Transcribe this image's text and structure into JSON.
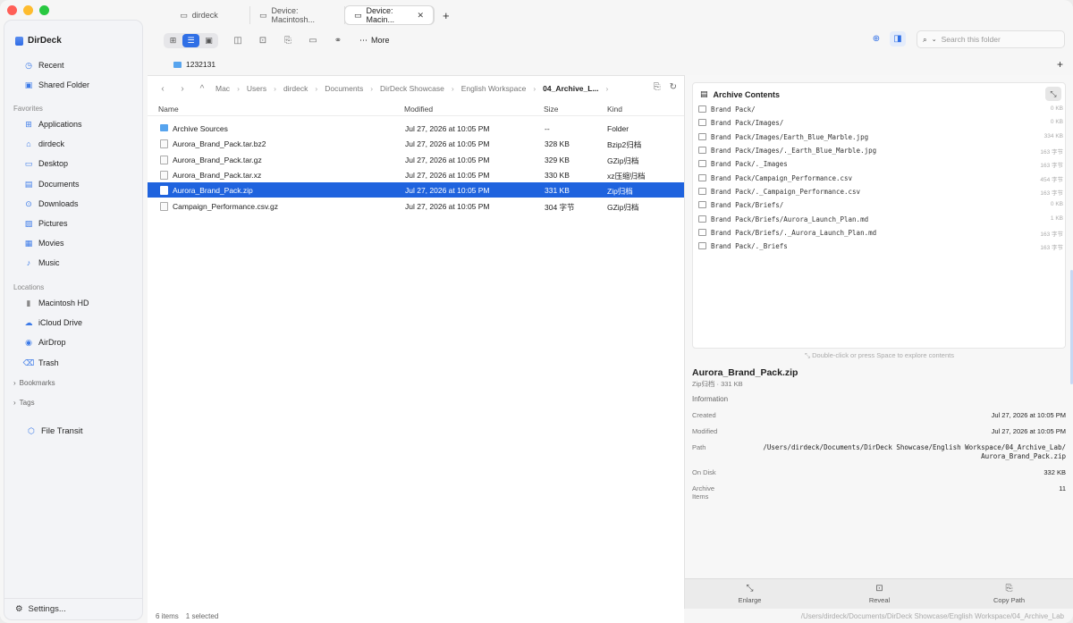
{
  "app": {
    "name": "DirDeck"
  },
  "tabs": [
    {
      "label": "dirdeck",
      "active": false
    },
    {
      "label": "Device: Macintosh...",
      "active": false
    },
    {
      "label": "Device: Macin...",
      "active": true
    }
  ],
  "sidebar": {
    "top": [
      {
        "label": "Recent",
        "icon": "clock-icon"
      },
      {
        "label": "Shared Folder",
        "icon": "shared-folder-icon"
      }
    ],
    "favorites_title": "Favorites",
    "favorites": [
      {
        "label": "Applications",
        "icon": "applications-icon"
      },
      {
        "label": "dirdeck",
        "icon": "home-icon"
      },
      {
        "label": "Desktop",
        "icon": "desktop-icon"
      },
      {
        "label": "Documents",
        "icon": "document-icon"
      },
      {
        "label": "Downloads",
        "icon": "download-icon"
      },
      {
        "label": "Pictures",
        "icon": "picture-icon"
      },
      {
        "label": "Movies",
        "icon": "movie-icon"
      },
      {
        "label": "Music",
        "icon": "music-icon"
      }
    ],
    "locations_title": "Locations",
    "locations": [
      {
        "label": "Macintosh HD",
        "icon": "disk-icon"
      },
      {
        "label": "iCloud Drive",
        "icon": "cloud-icon"
      },
      {
        "label": "AirDrop",
        "icon": "airdrop-icon"
      },
      {
        "label": "Trash",
        "icon": "trash-icon"
      }
    ],
    "bookmarks": "Bookmarks",
    "tags": "Tags",
    "file_transit": "File Transit",
    "settings": "Settings..."
  },
  "toolbar": {
    "more": "More",
    "search_placeholder": "Search this folder"
  },
  "pathbar": {
    "folder": "1232131"
  },
  "breadcrumbs": [
    "Mac",
    "Users",
    "dirdeck",
    "Documents",
    "DirDeck Showcase",
    "English Workspace",
    "04_Archive_L..."
  ],
  "table": {
    "headers": {
      "name": "Name",
      "modified": "Modified",
      "size": "Size",
      "kind": "Kind"
    },
    "rows": [
      {
        "name": "Archive Sources",
        "modified": "Jul 27, 2026 at 10:05 PM",
        "size": "--",
        "kind": "Folder",
        "folder": true
      },
      {
        "name": "Aurora_Brand_Pack.tar.bz2",
        "modified": "Jul 27, 2026 at 10:05 PM",
        "size": "328 KB",
        "kind": "Bzip2归档"
      },
      {
        "name": "Aurora_Brand_Pack.tar.gz",
        "modified": "Jul 27, 2026 at 10:05 PM",
        "size": "329 KB",
        "kind": "GZip归档"
      },
      {
        "name": "Aurora_Brand_Pack.tar.xz",
        "modified": "Jul 27, 2026 at 10:05 PM",
        "size": "330 KB",
        "kind": "xz压缩归档"
      },
      {
        "name": "Aurora_Brand_Pack.zip",
        "modified": "Jul 27, 2026 at 10:05 PM",
        "size": "331 KB",
        "kind": "Zip归档",
        "selected": true
      },
      {
        "name": "Campaign_Performance.csv.gz",
        "modified": "Jul 27, 2026 at 10:05 PM",
        "size": "304 字节",
        "kind": "GZip归档"
      }
    ]
  },
  "status": {
    "items": "6 items",
    "selected": "1 selected",
    "path": "/Users/dirdeck/Documents/DirDeck Showcase/English Workspace/04_Archive_Lab"
  },
  "archive": {
    "title": "Archive Contents",
    "entries": [
      {
        "name": "Brand Pack/",
        "size": "0 KB",
        "folder": true
      },
      {
        "name": "Brand Pack/Images/",
        "size": "0 KB",
        "folder": true
      },
      {
        "name": "Brand Pack/Images/Earth_Blue_Marble.jpg",
        "size": "334 KB"
      },
      {
        "name": "Brand Pack/Images/._Earth_Blue_Marble.jpg",
        "size": "163 字节"
      },
      {
        "name": "Brand Pack/._Images",
        "size": "163 字节"
      },
      {
        "name": "Brand Pack/Campaign_Performance.csv",
        "size": "454 字节"
      },
      {
        "name": "Brand Pack/._Campaign_Performance.csv",
        "size": "163 字节"
      },
      {
        "name": "Brand Pack/Briefs/",
        "size": "0 KB",
        "folder": true
      },
      {
        "name": "Brand Pack/Briefs/Aurora_Launch_Plan.md",
        "size": "1 KB"
      },
      {
        "name": "Brand Pack/Briefs/._Aurora_Launch_Plan.md",
        "size": "163 字节"
      },
      {
        "name": "Brand Pack/._Briefs",
        "size": "163 字节"
      }
    ],
    "hint": "Double-click or press Space to explore contents"
  },
  "details": {
    "name": "Aurora_Brand_Pack.zip",
    "kind": "Zip归档 · 331 KB",
    "info_title": "Information",
    "created_label": "Created",
    "created": "Jul 27, 2026 at 10:05 PM",
    "modified_label": "Modified",
    "modified": "Jul 27, 2026 at 10:05 PM",
    "path_label": "Path",
    "path_line1": "/Users/dirdeck/Documents/DirDeck Showcase/English Workspace/04_Archive_Lab/",
    "path_line2": "Aurora_Brand_Pack.zip",
    "disk_label": "On Disk",
    "disk": "332 KB",
    "items_label_1": "Archive",
    "items_label_2": "Items",
    "items": "11"
  },
  "actions": {
    "enlarge": "Enlarge",
    "reveal": "Reveal",
    "copy_path": "Copy Path"
  },
  "colors": {
    "accent": "#1f63de",
    "selection": "#1f63de"
  }
}
